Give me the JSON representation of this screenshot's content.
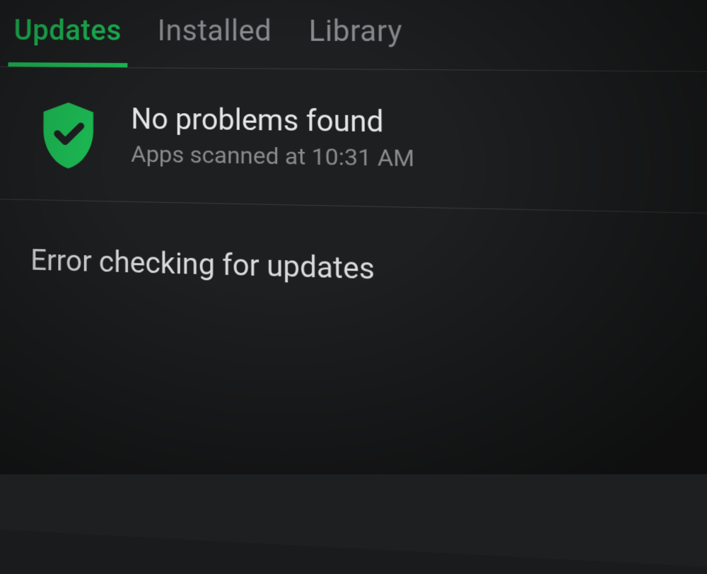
{
  "tabs": {
    "updates": "Updates",
    "installed": "Installed",
    "library": "Library"
  },
  "scan": {
    "title": "No problems found",
    "subtitle": "Apps scanned at 10:31 AM"
  },
  "error": {
    "text": "Error checking for updates"
  },
  "colors": {
    "accent": "#1db954",
    "background": "#1e1f20"
  }
}
